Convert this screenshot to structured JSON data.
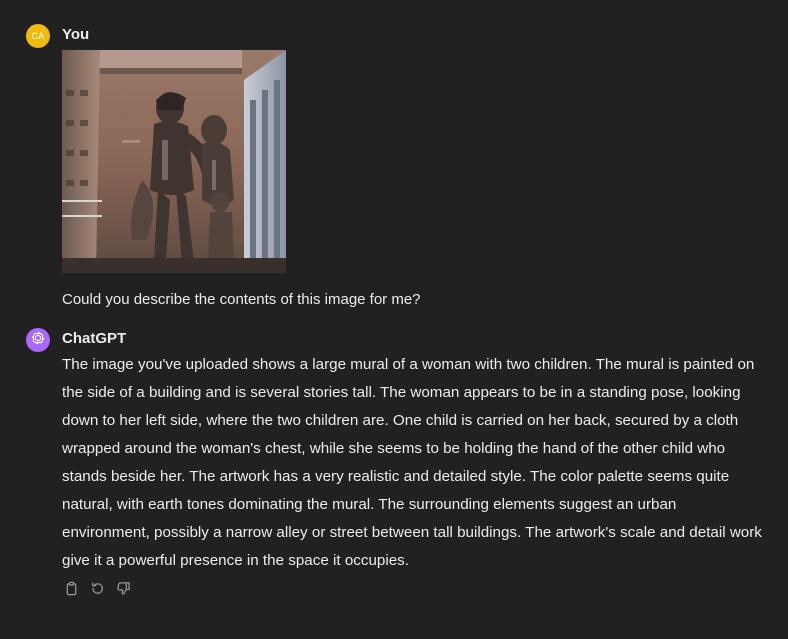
{
  "conversation": {
    "user": {
      "avatar_initials": "CA",
      "avatar_color": "#f2b90f",
      "author": "You",
      "image_alt": "Mural of a woman with two children on a building wall",
      "text": "Could you describe the contents of this image for me?"
    },
    "assistant": {
      "avatar_color": "#ab68ff",
      "avatar_icon": "openai-logo-icon",
      "author": "ChatGPT",
      "text": "The image you've uploaded shows a large mural of a woman with two children. The mural is painted on the side of a building and is several stories tall. The woman appears to be in a standing pose, looking down to her left side, where the two children are. One child is carried on her back, secured by a cloth wrapped around the woman's chest, while she seems to be holding the hand of the other child who stands beside her. The artwork has a very realistic and detailed style. The color palette seems quite natural, with earth tones dominating the mural. The surrounding elements suggest an urban environment, possibly a narrow alley or street between tall buildings. The artwork's scale and detail work give it a powerful presence in the space it occupies.",
      "actions": [
        "copy-icon",
        "regenerate-icon",
        "thumbs-down-icon"
      ]
    }
  },
  "colors": {
    "background": "#212121",
    "text": "#ececec",
    "icon": "#9b9b9b"
  }
}
